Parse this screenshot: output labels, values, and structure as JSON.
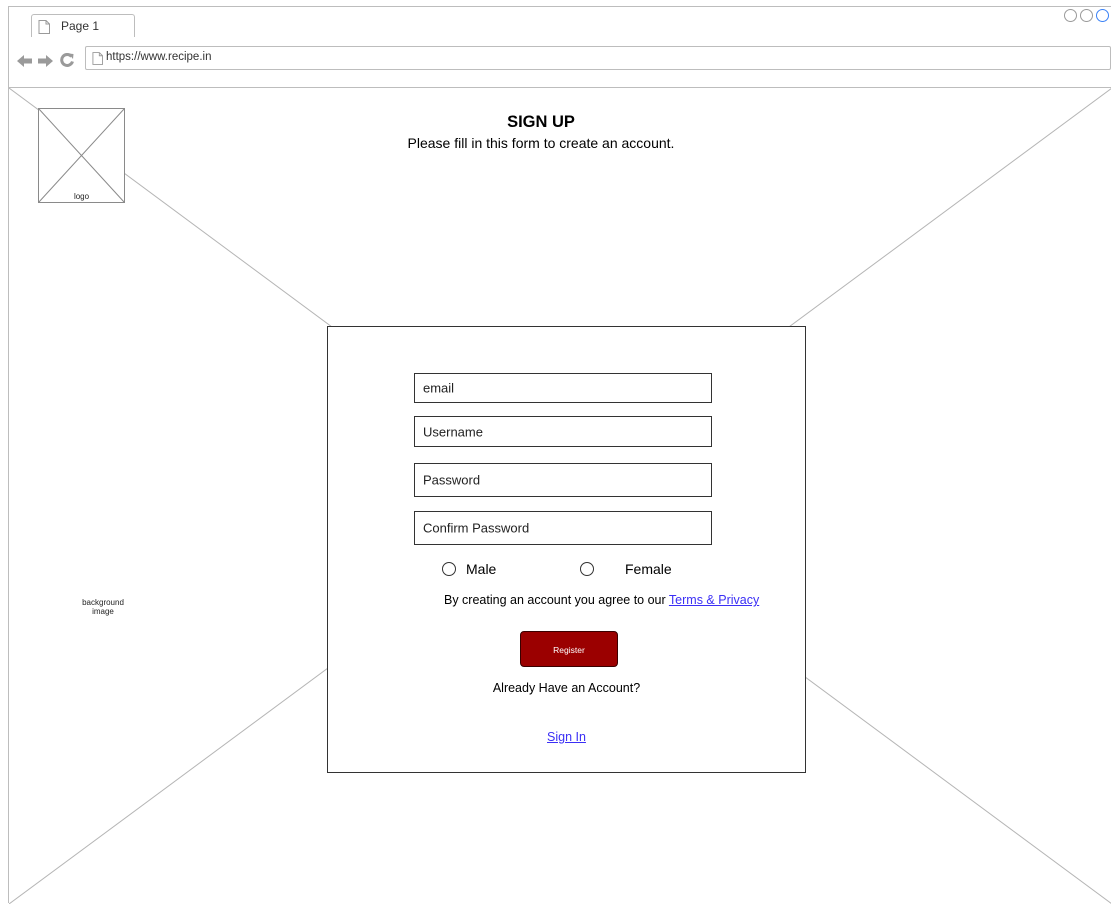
{
  "browser": {
    "tab_title": "Page 1",
    "url": "https://www.recipe.in"
  },
  "background": {
    "label_line1": "background",
    "label_line2": "image"
  },
  "logo": {
    "label": "logo"
  },
  "header": {
    "title": "SIGN UP",
    "subtitle": "Please fill in this form to create an account."
  },
  "form": {
    "email_placeholder": "email",
    "username_placeholder": "Username",
    "password_placeholder": "Password",
    "confirm_password_placeholder": "Confirm Password",
    "gender_options": [
      "Male",
      "Female"
    ],
    "agree_text": "By creating an account you agree to our ",
    "terms_link": "Terms & Privacy ",
    "register_label": "Register",
    "already_text": "Already Have an Account?",
    "signin_link": "Sign In"
  },
  "colors": {
    "register_button": "#9b0000",
    "link": "#3b2ff5"
  }
}
